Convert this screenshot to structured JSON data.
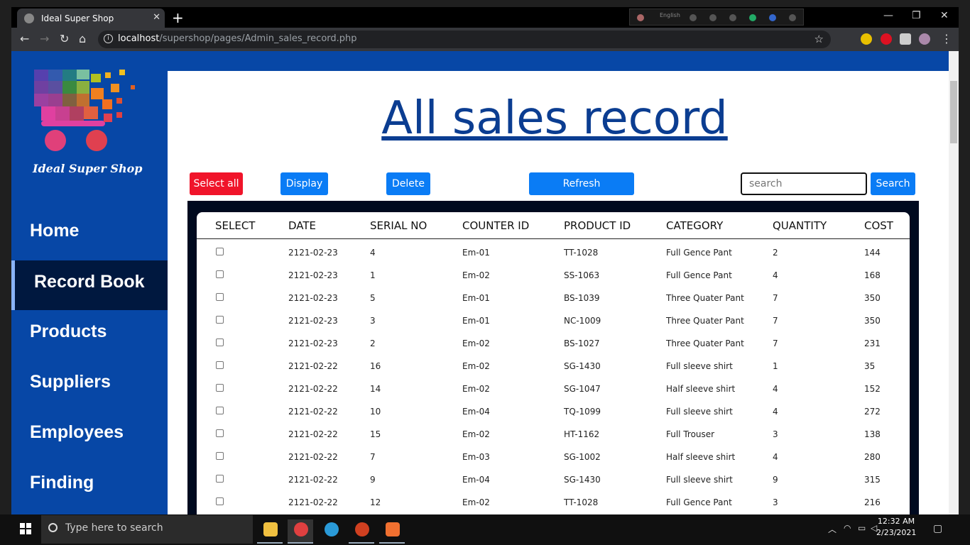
{
  "browser": {
    "tab_title": "Ideal Super Shop",
    "tab_close": "✕",
    "new_tab": "+",
    "extension_strip_label": "English",
    "url_host": "localhost",
    "url_path": "/supershop/pages/Admin_sales_record.php",
    "window_minimize": "—",
    "window_restore": "❐",
    "window_close": "✕"
  },
  "sidebar": {
    "brand": "Ideal Super Shop",
    "items": [
      {
        "label": "Home"
      },
      {
        "label": "Record Book"
      },
      {
        "label": "Products"
      },
      {
        "label": "Suppliers"
      },
      {
        "label": "Employees"
      },
      {
        "label": "Finding"
      }
    ]
  },
  "main": {
    "title": "All sales record",
    "buttons": {
      "select_all": "Select all",
      "display": "Display",
      "delete": "Delete",
      "refresh": "Refresh",
      "search": "Search"
    },
    "search_placeholder": "search"
  },
  "table": {
    "headers": [
      "SELECT",
      "DATE",
      "SERIAL NO",
      "COUNTER ID",
      "PRODUCT ID",
      "CATEGORY",
      "QUANTITY",
      "COST"
    ],
    "rows": [
      {
        "date": "2121-02-23",
        "serial": "4",
        "counter": "Em-01",
        "product": "TT-1028",
        "category": "Full Gence Pant",
        "quantity": "2",
        "cost": "144"
      },
      {
        "date": "2121-02-23",
        "serial": "1",
        "counter": "Em-02",
        "product": "SS-1063",
        "category": "Full Gence Pant",
        "quantity": "4",
        "cost": "168"
      },
      {
        "date": "2121-02-23",
        "serial": "5",
        "counter": "Em-01",
        "product": "BS-1039",
        "category": "Three Quater Pant",
        "quantity": "7",
        "cost": "350"
      },
      {
        "date": "2121-02-23",
        "serial": "3",
        "counter": "Em-01",
        "product": "NC-1009",
        "category": "Three Quater Pant",
        "quantity": "7",
        "cost": "350"
      },
      {
        "date": "2121-02-23",
        "serial": "2",
        "counter": "Em-02",
        "product": "BS-1027",
        "category": "Three Quater Pant",
        "quantity": "7",
        "cost": "231"
      },
      {
        "date": "2121-02-22",
        "serial": "16",
        "counter": "Em-02",
        "product": "SG-1430",
        "category": "Full sleeve shirt",
        "quantity": "1",
        "cost": "35"
      },
      {
        "date": "2121-02-22",
        "serial": "14",
        "counter": "Em-02",
        "product": "SG-1047",
        "category": "Half sleeve shirt",
        "quantity": "4",
        "cost": "152"
      },
      {
        "date": "2121-02-22",
        "serial": "10",
        "counter": "Em-04",
        "product": "TQ-1099",
        "category": "Full sleeve shirt",
        "quantity": "4",
        "cost": "272"
      },
      {
        "date": "2121-02-22",
        "serial": "15",
        "counter": "Em-02",
        "product": "HT-1162",
        "category": "Full Trouser",
        "quantity": "3",
        "cost": "138"
      },
      {
        "date": "2121-02-22",
        "serial": "7",
        "counter": "Em-03",
        "product": "SG-1002",
        "category": "Half sleeve shirt",
        "quantity": "4",
        "cost": "280"
      },
      {
        "date": "2121-02-22",
        "serial": "9",
        "counter": "Em-04",
        "product": "SG-1430",
        "category": "Full sleeve shirt",
        "quantity": "9",
        "cost": "315"
      },
      {
        "date": "2121-02-22",
        "serial": "12",
        "counter": "Em-02",
        "product": "TT-1028",
        "category": "Full Gence Pant",
        "quantity": "3",
        "cost": "216"
      }
    ]
  },
  "taskbar": {
    "search_placeholder": "Type here to search",
    "time": "12:32 AM",
    "date": "2/23/2021"
  },
  "colors": {
    "sidebar_bg": "#0747a6",
    "sidebar_active": "#00183f",
    "title": "#0b3d91",
    "button_blue": "#0a7cf5",
    "button_red": "#f0142a"
  }
}
